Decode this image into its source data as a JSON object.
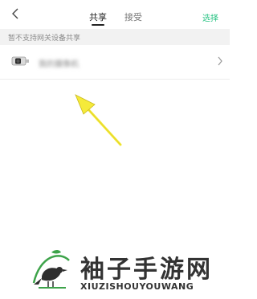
{
  "header": {
    "back_icon": "chevron-left-icon",
    "tabs": [
      {
        "label": "共享",
        "active": true
      },
      {
        "label": "接受",
        "active": false
      }
    ],
    "select_label": "选择"
  },
  "notice": {
    "text": "暂不支持网关设备共享"
  },
  "devices": [
    {
      "name": "我的摄像机",
      "icon": "camera-icon",
      "trailing_icon": "chevron-right-icon"
    }
  ],
  "annotation": {
    "icon": "pointer-arrow-icon",
    "color": "#f5ea3a"
  },
  "watermark": {
    "title": "袖子手游网",
    "subtitle": "XIUZISHOUYOUWANG"
  },
  "colors": {
    "accent": "#26c281",
    "notice_bg": "#f2f2f2"
  }
}
